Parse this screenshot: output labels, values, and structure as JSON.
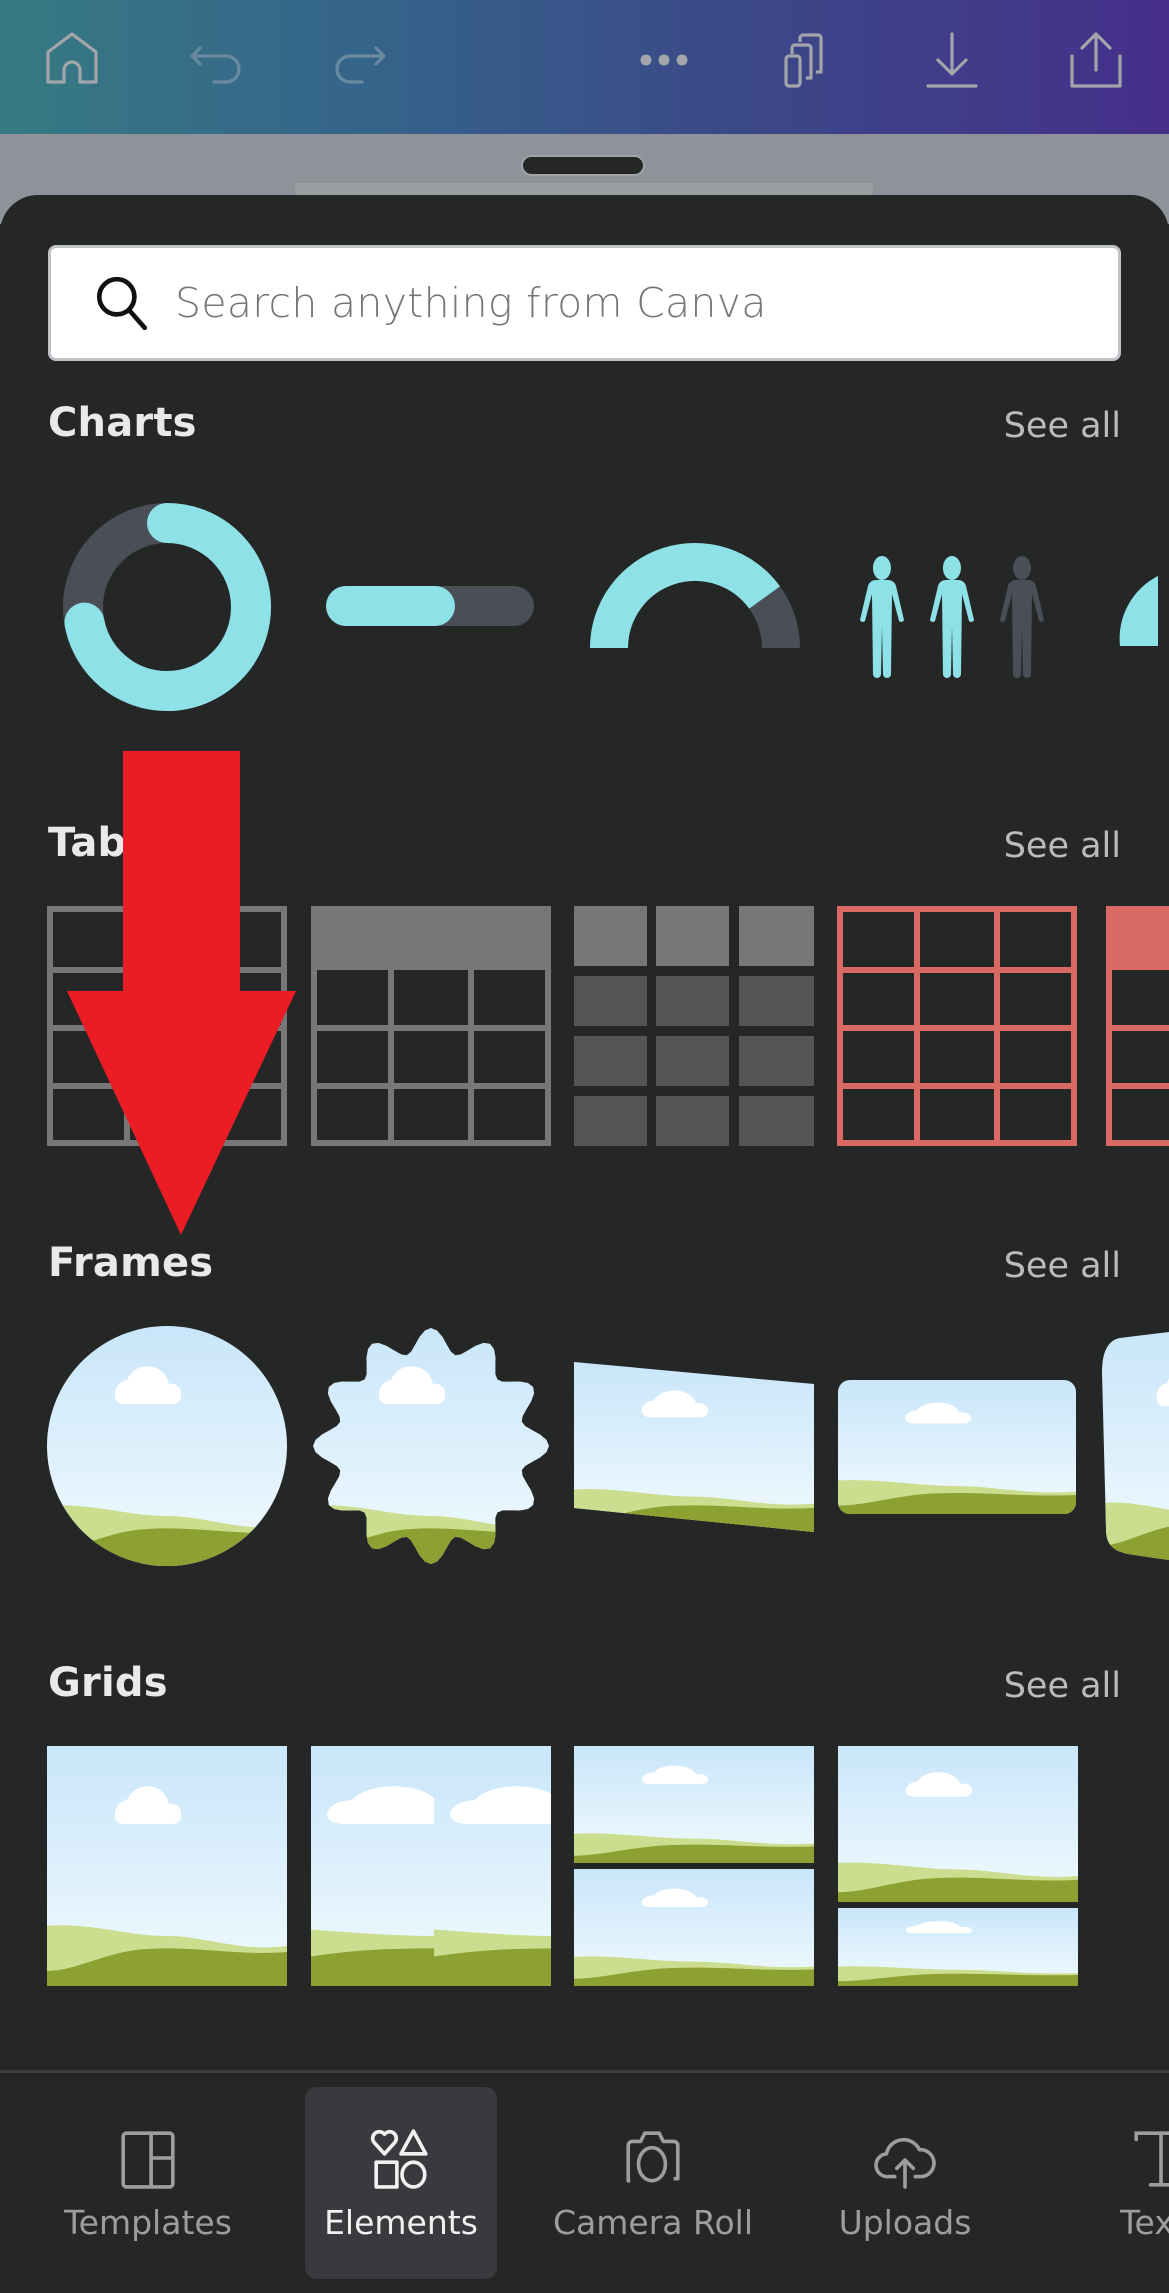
{
  "topbar": {
    "icons": [
      "home-icon",
      "undo-icon",
      "redo-icon",
      "more-icon",
      "pages-icon",
      "download-icon",
      "share-icon"
    ],
    "gradient": [
      "#377a83",
      "#462f8a"
    ]
  },
  "search": {
    "placeholder": "Search anything from Canva",
    "value": ""
  },
  "sections": [
    {
      "title": "Charts",
      "see_all": "See all",
      "items": [
        {
          "type": "donut-chart",
          "value": 0.72
        },
        {
          "type": "progress-bar",
          "value": 0.62
        },
        {
          "type": "half-dial",
          "value": 0.8
        },
        {
          "type": "pictogram",
          "filled": 2,
          "total": 3
        },
        {
          "type": "partial-chart"
        }
      ]
    },
    {
      "title": "Tables",
      "title_visible": "Tab",
      "see_all": "See all",
      "items": [
        {
          "type": "grey-outline-table",
          "cols": 3,
          "rows": 4
        },
        {
          "type": "grey-header-table",
          "cols": 3,
          "rows": 4
        },
        {
          "type": "grey-block-table",
          "cols": 3,
          "rows": 4
        },
        {
          "type": "red-outline-table",
          "cols": 3,
          "rows": 4
        },
        {
          "type": "red-header-table"
        }
      ]
    },
    {
      "title": "Frames",
      "see_all": "See all",
      "items": [
        {
          "type": "circle-frame"
        },
        {
          "type": "scalloped-frame"
        },
        {
          "type": "skewed-frame"
        },
        {
          "type": "rounded-rect-frame"
        },
        {
          "type": "curved-frame"
        }
      ]
    },
    {
      "title": "Grids",
      "see_all": "See all",
      "items": [
        {
          "type": "single-grid"
        },
        {
          "type": "two-column-grid"
        },
        {
          "type": "two-row-grid"
        },
        {
          "type": "top-large-grid"
        }
      ]
    }
  ],
  "colors": {
    "chart_accent": "#8ee2e7",
    "chart_track": "#4a4f57",
    "table_grey": "#777777",
    "table_red": "#d96a63",
    "annotation_arrow": "#ec1c24",
    "sky_top": "#c9e6fa",
    "hill_light": "#cbdd8f",
    "hill_dark": "#8ca132"
  },
  "bottom_nav": [
    {
      "label": "Templates",
      "icon": "templates-icon",
      "active": false
    },
    {
      "label": "Elements",
      "icon": "elements-icon",
      "active": true
    },
    {
      "label": "Camera Roll",
      "icon": "camera-icon",
      "active": false
    },
    {
      "label": "Uploads",
      "icon": "upload-cloud-icon",
      "active": false
    },
    {
      "label": "Text",
      "visible_label": "Tex",
      "icon": "text-icon",
      "active": false
    }
  ]
}
